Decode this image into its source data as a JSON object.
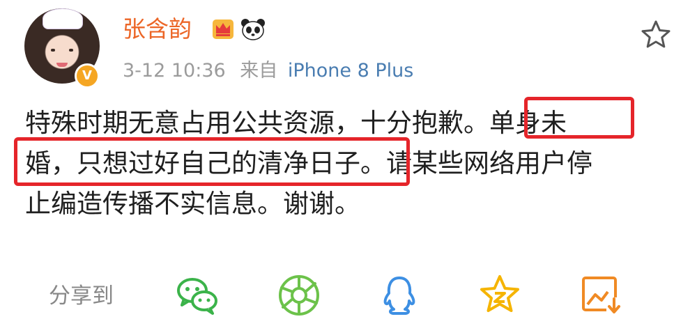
{
  "post": {
    "username": "张含韵",
    "verified_badge": "V",
    "timestamp": "3-12 10:36",
    "source_prefix": "来自",
    "source_device": "iPhone 8 Plus",
    "lines": [
      "特殊时期无意占用公共资源，十分抱歉。单身未",
      "婚，只想过好自己的清净日子。请某些网络用户停",
      "止编造传播不实信息。谢谢。"
    ]
  },
  "share": {
    "label": "分享到",
    "targets": [
      "wechat-icon",
      "moments-icon",
      "qq-icon",
      "qzone-icon",
      "save-image-icon"
    ]
  },
  "icons": [
    "crown-icon",
    "panda-icon",
    "star-icon"
  ],
  "colors": {
    "username": "#ec6627",
    "source_link": "#4a7db1",
    "highlight_box": "#e5252a",
    "wechat": "#3bb34a",
    "moments": "#6cc24a",
    "qq": "#3d8fe3",
    "qzone": "#f5b400",
    "save": "#f08a24"
  }
}
